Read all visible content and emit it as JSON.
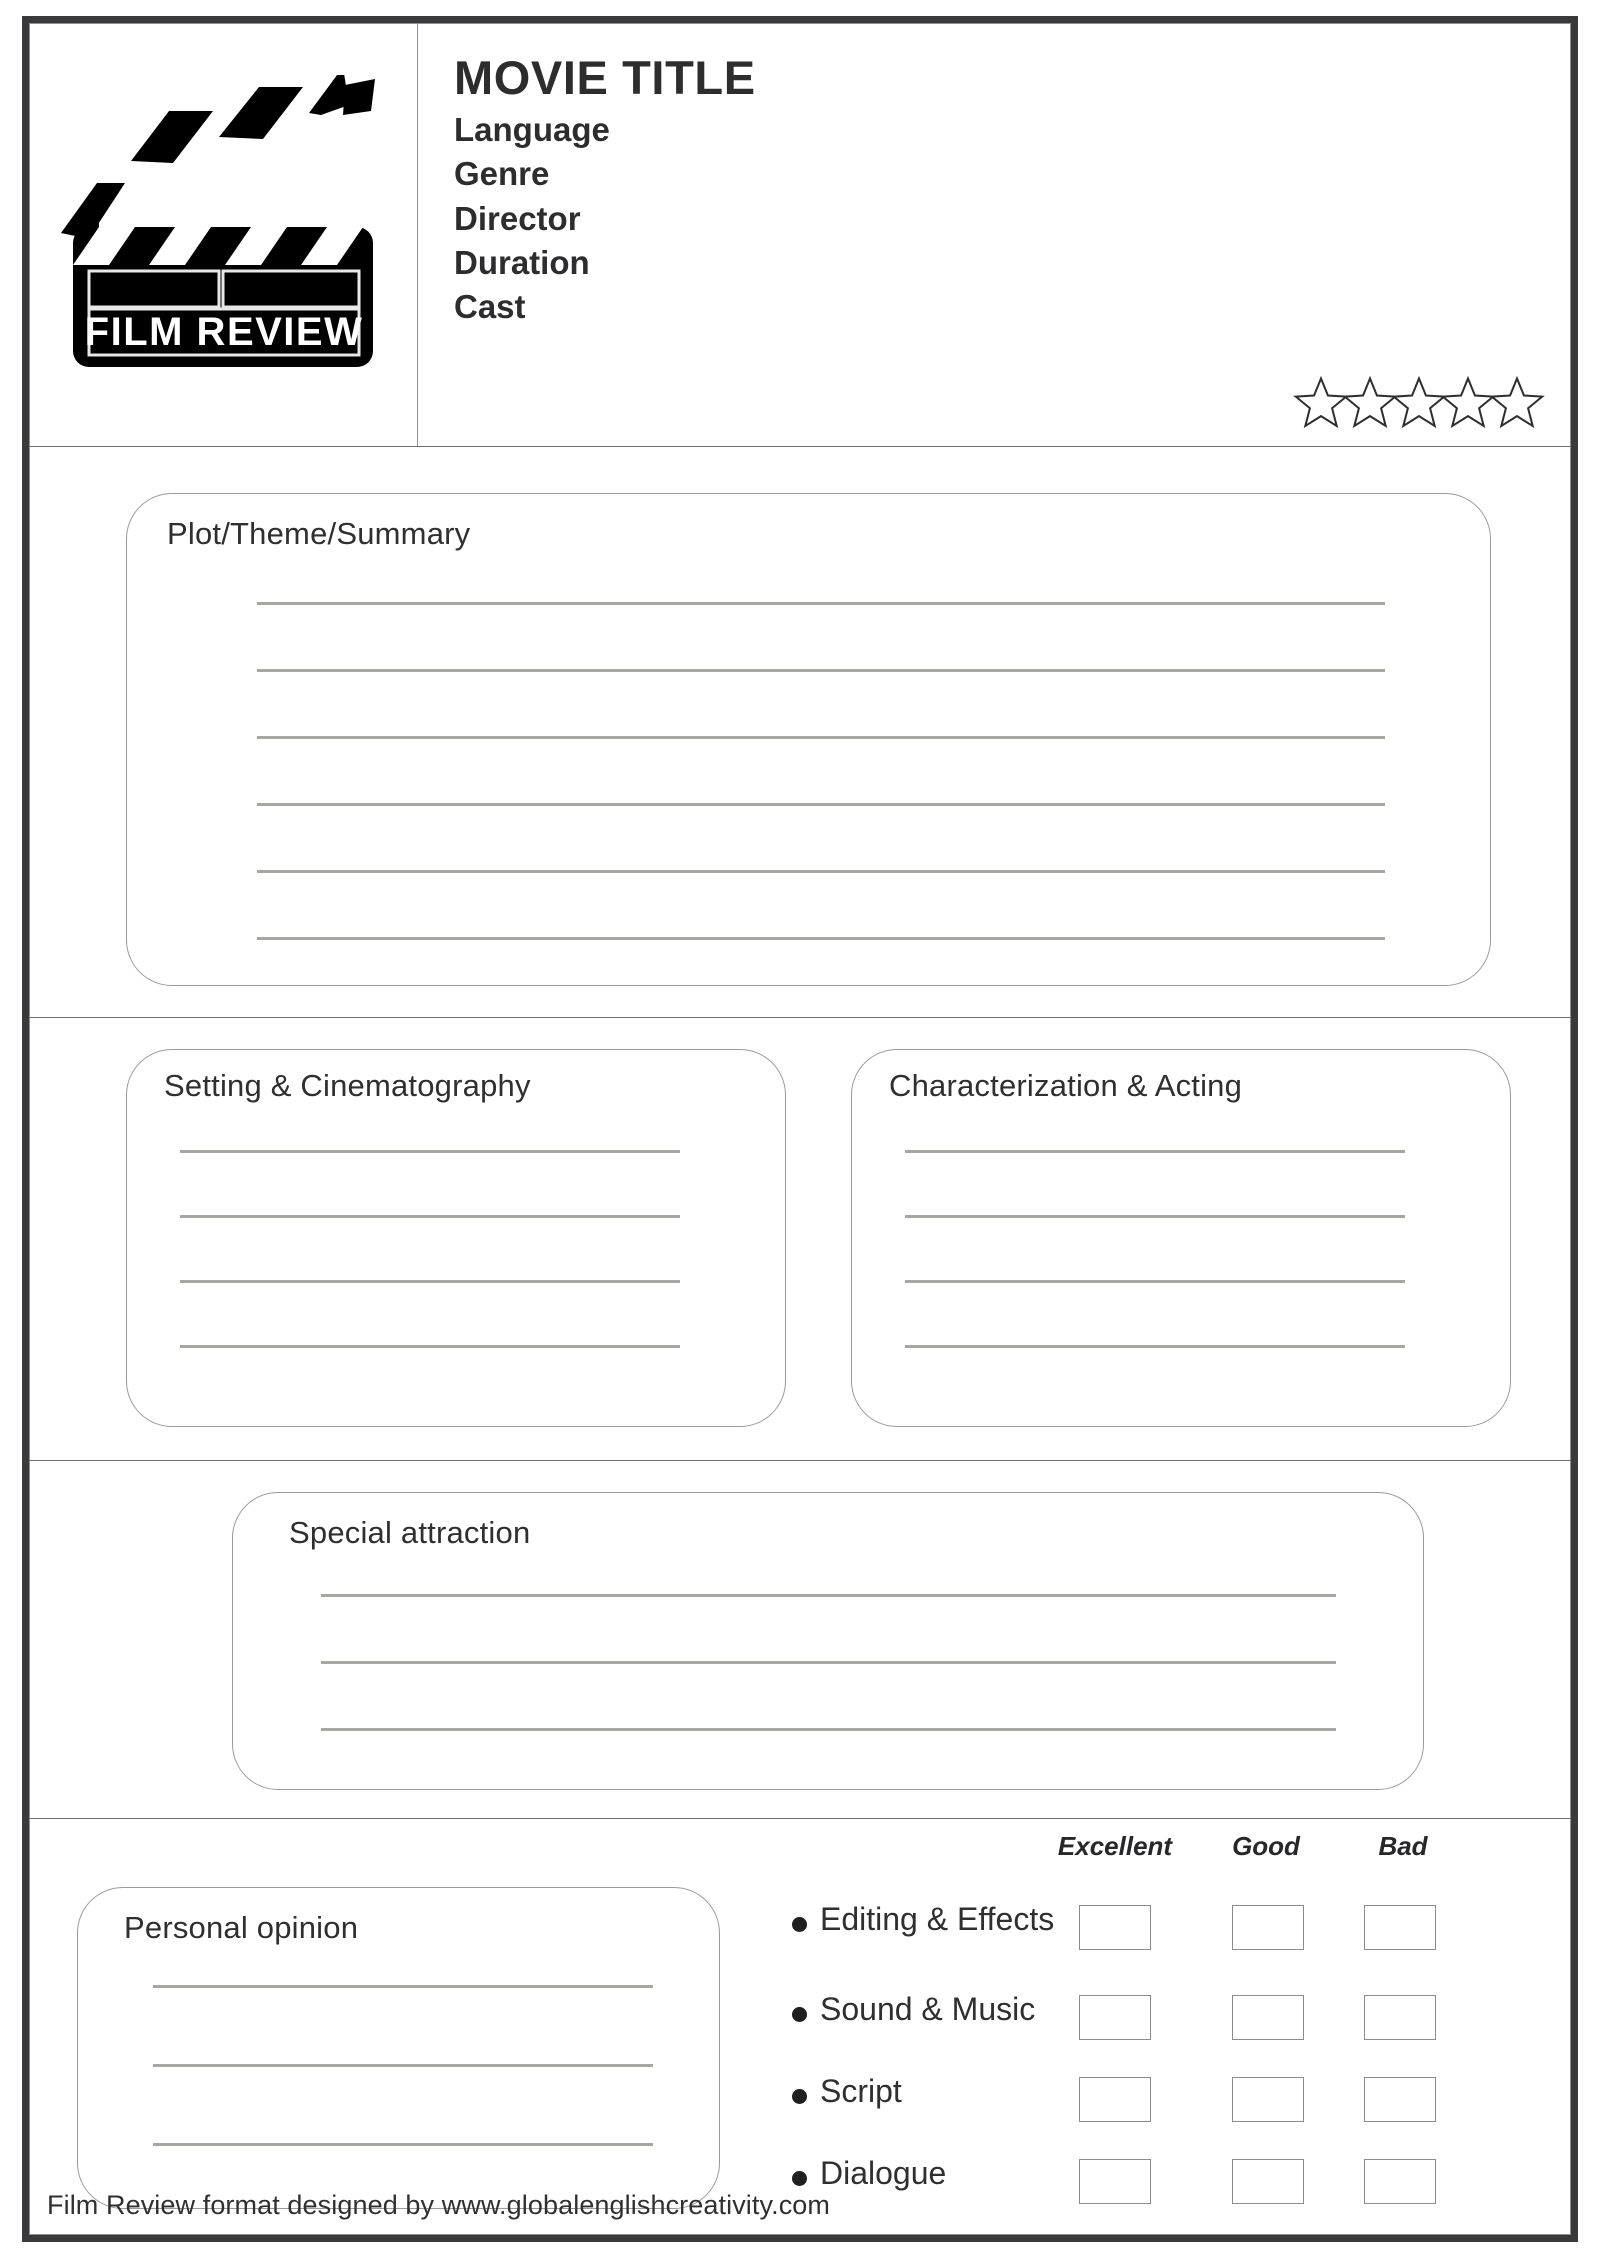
{
  "document": {
    "type": "film-review-worksheet",
    "footer": "Film Review format designed by www.globalenglishcreativity.com"
  },
  "header": {
    "logo": {
      "icon": "clapperboard-icon",
      "caption": "FILM REVIEW"
    },
    "title": "MOVIE TITLE",
    "fields": [
      "Language",
      "Genre",
      "Director",
      "Duration",
      "Cast"
    ],
    "rating_stars": {
      "icon": "star-outline-icon",
      "count": 5,
      "filled": 0
    }
  },
  "sections": {
    "plot": {
      "label": "Plot/Theme/Summary",
      "lines": 6
    },
    "setting": {
      "label": "Setting & Cinematography",
      "lines": 4
    },
    "characterization": {
      "label": "Characterization & Acting",
      "lines": 4
    },
    "special_attraction": {
      "label": "Special attraction",
      "lines": 3
    },
    "personal_opinion": {
      "label": "Personal opinion",
      "lines": 3
    }
  },
  "ratings": {
    "columns": [
      "Excellent",
      "Good",
      "Bad"
    ],
    "rows": [
      "Editing & Effects",
      "Sound & Music",
      "Script",
      "Dialogue"
    ]
  },
  "colors": {
    "frame": "#3a3a3c",
    "divider": "#6e6e70",
    "card_border": "#9a9a9c",
    "rule": "#a6a6a2",
    "text": "#2f2f31",
    "logo": "#000000"
  }
}
